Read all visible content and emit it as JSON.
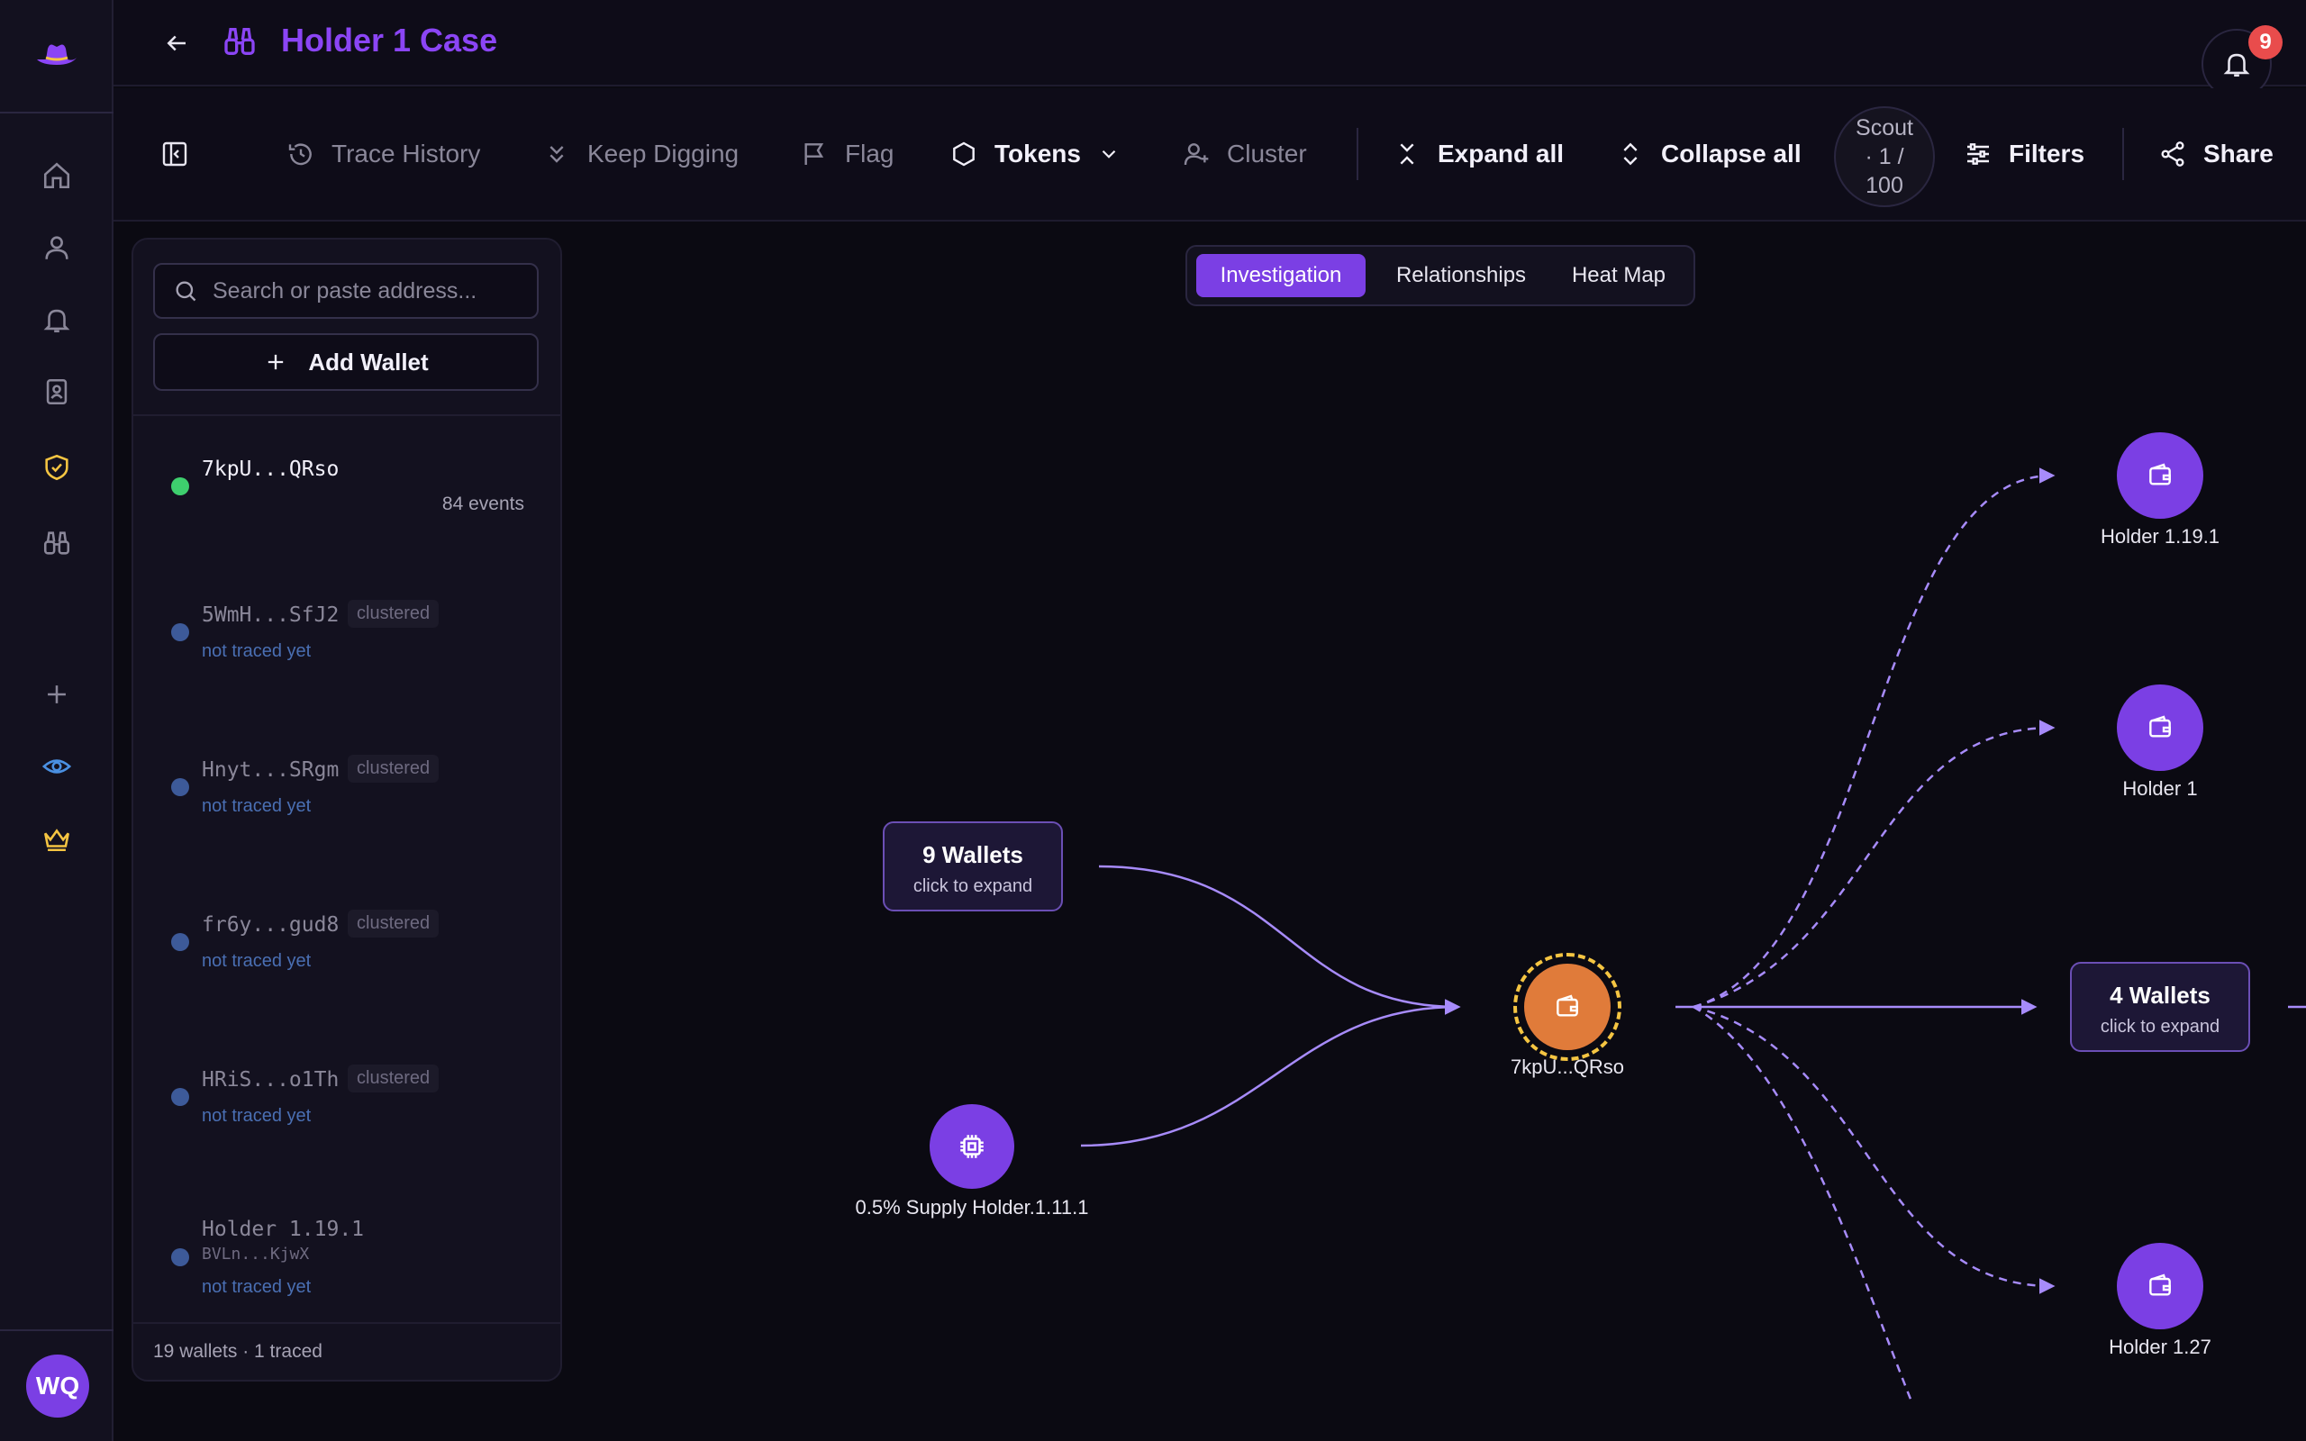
{
  "header": {
    "title": "Holder 1 Case",
    "notification_count": "9"
  },
  "toolbar": {
    "trace_history": "Trace History",
    "keep_digging": "Keep Digging",
    "flag": "Flag",
    "tokens": "Tokens",
    "cluster": "Cluster",
    "expand_all": "Expand all",
    "collapse_all": "Collapse all",
    "scout_line1": "Scout",
    "scout_line2": "· 1 /",
    "scout_line3": "100",
    "filters": "Filters",
    "share": "Share"
  },
  "sidebar": {
    "avatar_initials": "WQ"
  },
  "panel": {
    "search_placeholder": "Search or paste address...",
    "add_wallet": "Add Wallet",
    "wallets": [
      {
        "address": "7kpU...QRso",
        "events": "84 events",
        "status_color": "#3ecf6e"
      },
      {
        "address": "5WmH...SfJ2",
        "tag": "clustered",
        "status": "not traced yet",
        "status_color": "#3d5a99"
      },
      {
        "address": "Hnyt...SRgm",
        "tag": "clustered",
        "status": "not traced yet",
        "status_color": "#3d5a99"
      },
      {
        "address": "fr6y...gud8",
        "tag": "clustered",
        "status": "not traced yet",
        "status_color": "#3d5a99"
      },
      {
        "address": "HRiS...o1Th",
        "tag": "clustered",
        "status": "not traced yet",
        "status_color": "#3d5a99"
      },
      {
        "address": "Holder 1.19.1",
        "sub_address": "BVLn...KjwX",
        "status": "not traced yet",
        "status_color": "#3d5a99"
      }
    ],
    "footer": "19 wallets · 1 traced"
  },
  "view_tabs": [
    "Investigation",
    "Relationships",
    "Heat Map"
  ],
  "graph": {
    "group_left": {
      "title": "9 Wallets",
      "sub": "click to expand"
    },
    "supply_holder": "0.5% Supply Holder.1.11.1",
    "center": "7kpU...QRso",
    "holder_1191": "Holder 1.19.1",
    "holder_1": "Holder 1",
    "group_right": {
      "title": "4 Wallets",
      "sub": "click to expand"
    },
    "holder_127": "Holder 1.27"
  },
  "colors": {
    "accent": "#7b3fe4",
    "center_node": "#e07b3a",
    "center_ring": "#f5c542",
    "edge": "#a78bfa"
  }
}
